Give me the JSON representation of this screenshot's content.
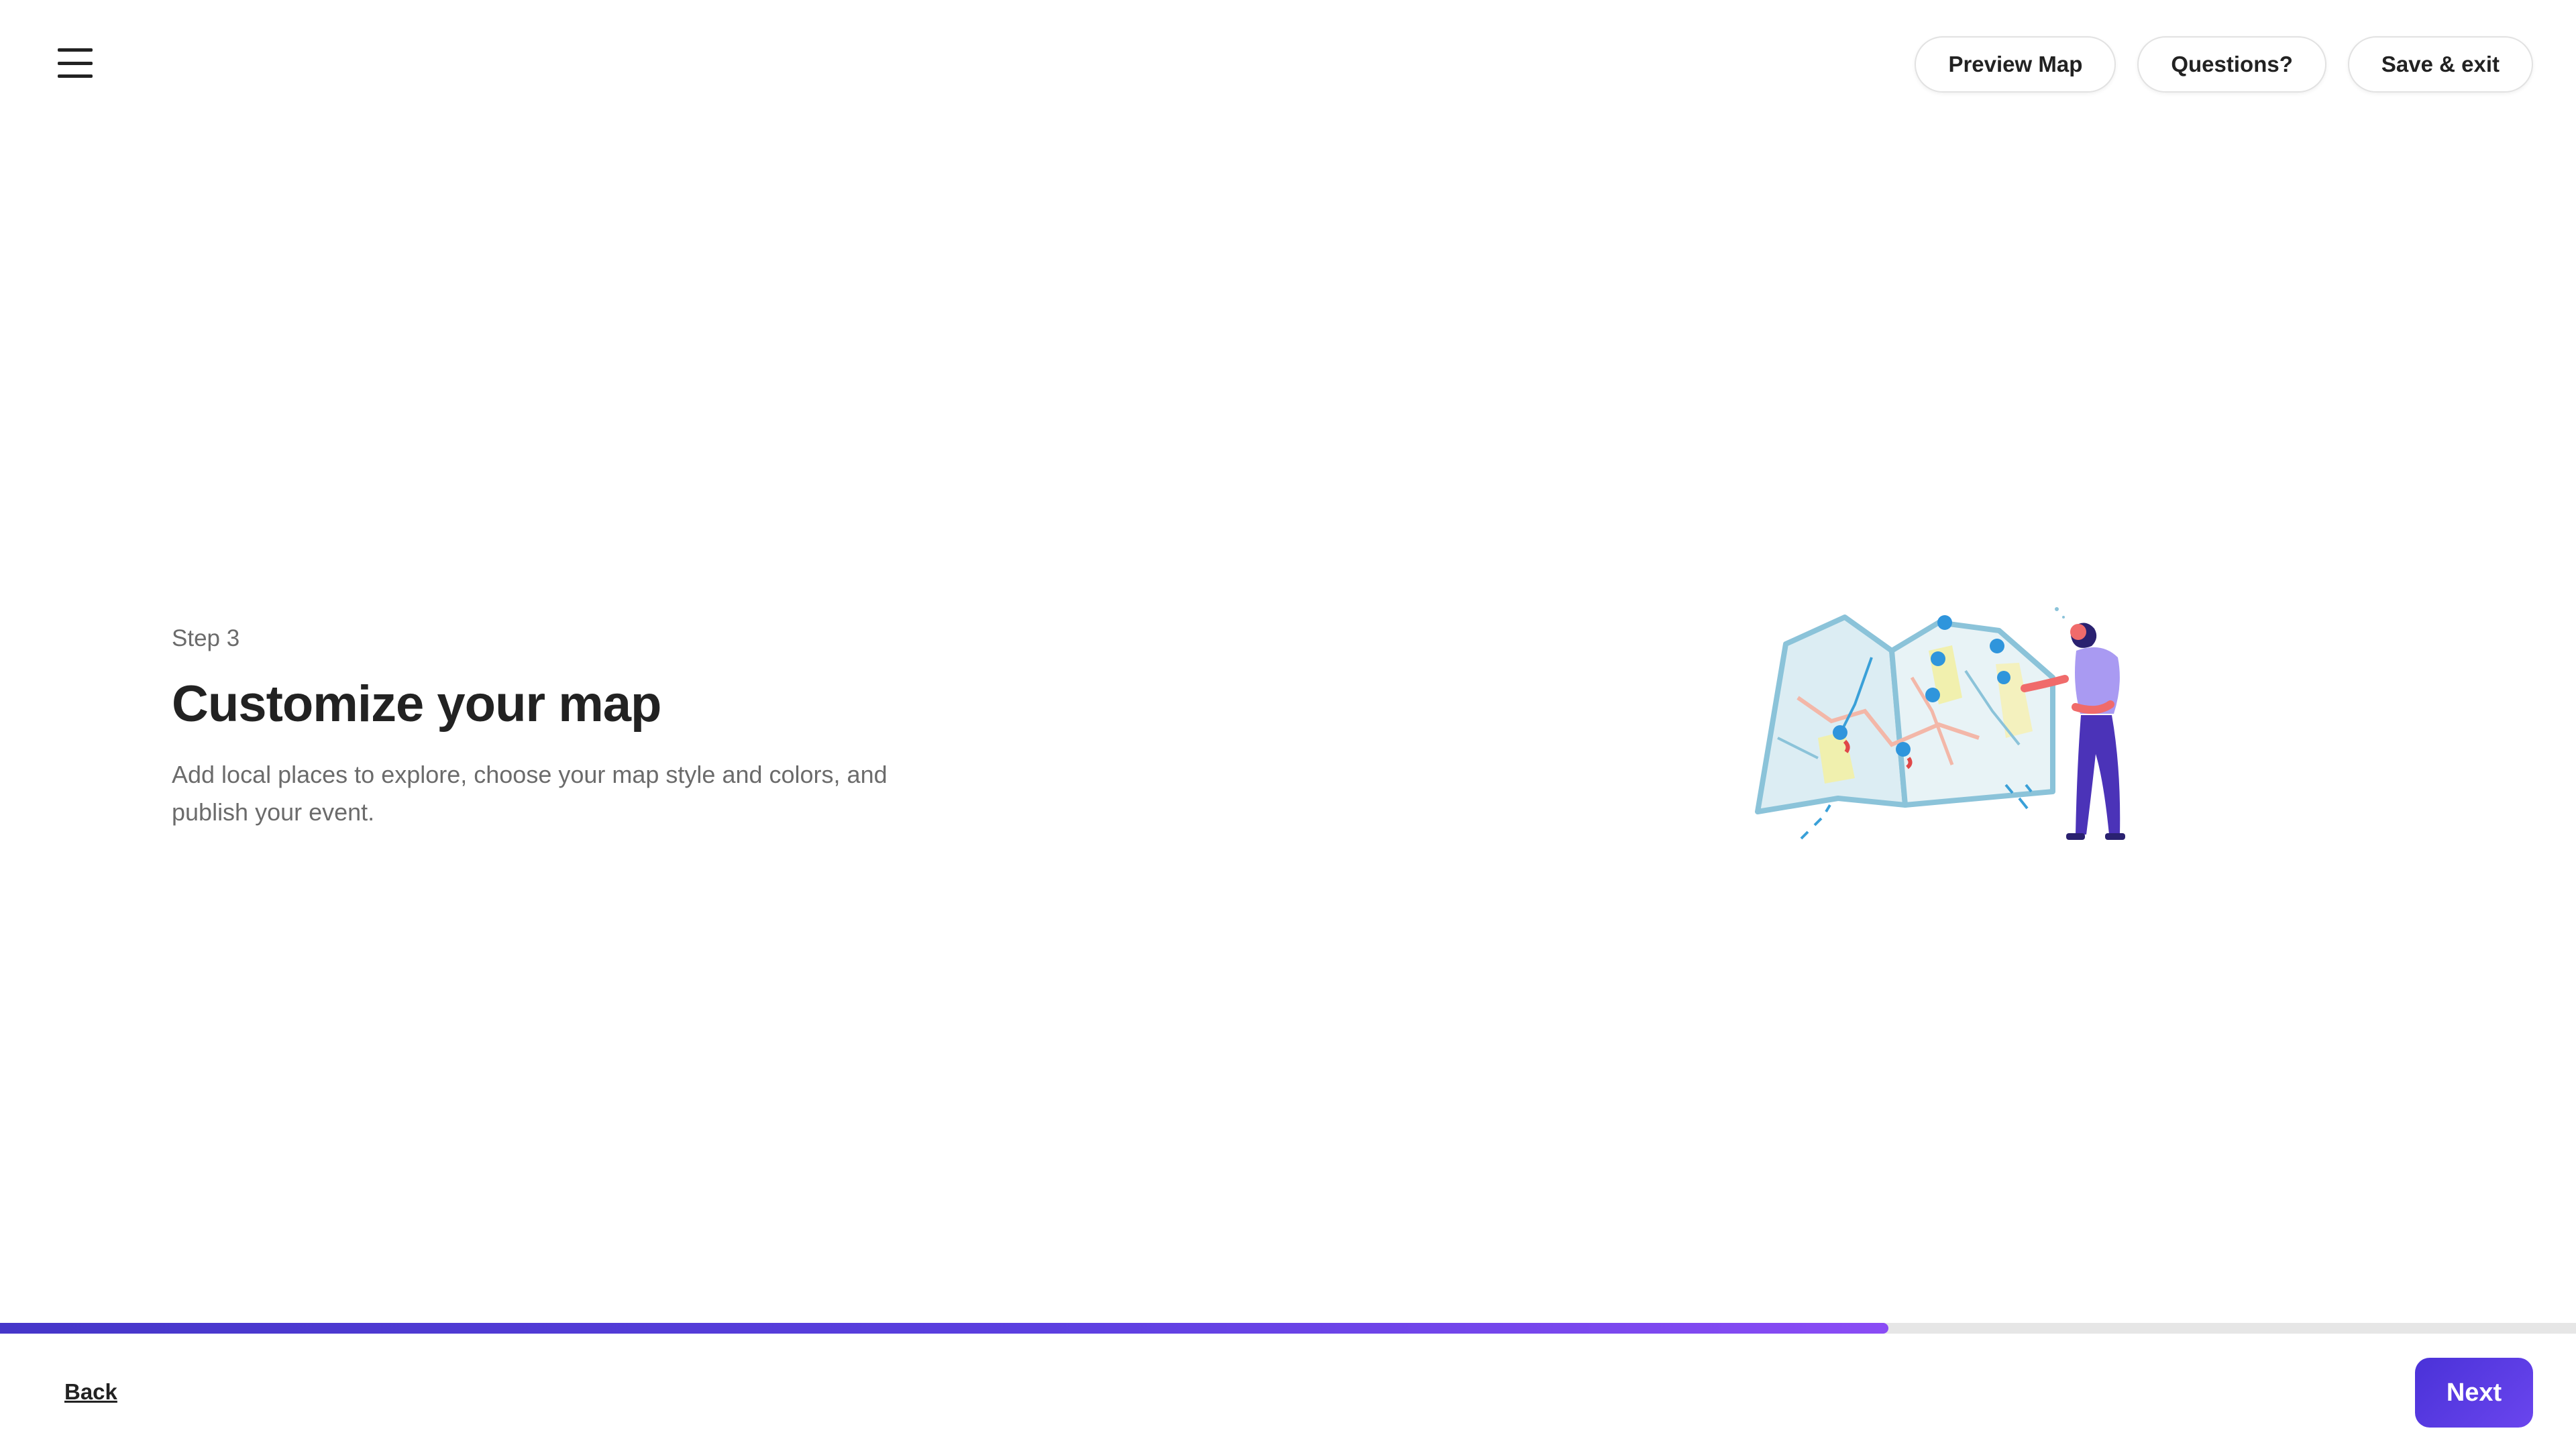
{
  "header": {
    "menu_icon": "hamburger-menu-icon",
    "preview_label": "Preview Map",
    "questions_label": "Questions?",
    "save_exit_label": "Save & exit"
  },
  "hero": {
    "step": "Step 3",
    "title": "Customize your map",
    "description": "Add local places to explore, choose your map style and colors, and publish your event.",
    "illustration": "person-with-map-illustration"
  },
  "progress": {
    "value": 0.733,
    "colors": [
      "#4536c9",
      "#8a4cf5"
    ]
  },
  "footer": {
    "back_label": "Back",
    "next_label": "Next"
  },
  "colors": {
    "accent": "#5b3fe0",
    "track": "#e6e6e6"
  }
}
